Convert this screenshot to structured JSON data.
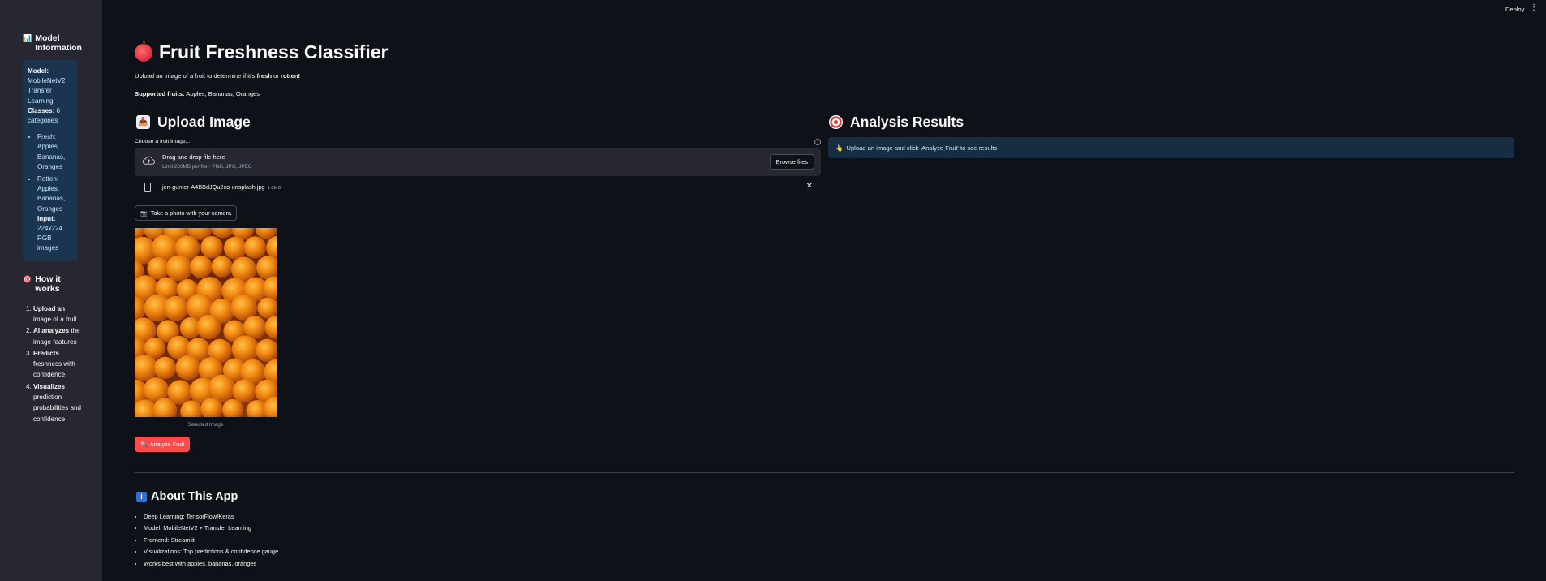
{
  "topbar": {
    "deploy_label": "Deploy",
    "menu_icon": "⋮"
  },
  "sidebar": {
    "model_info_title": "Model Information",
    "model_label": "Model:",
    "model_value": "MobileNetV2 Transfer Learning",
    "classes_label": "Classes:",
    "classes_value": "6 categories",
    "fresh_label": "Fresh:",
    "fresh_value": "Apples, Bananas, Oranges",
    "rotten_label": "Rotten:",
    "rotten_value": "Apples, Bananas, Oranges",
    "input_label": "Input:",
    "input_value": "224x224 RGB images",
    "how_title": "How it works",
    "steps": [
      {
        "bold": "Upload an",
        "rest": "image of a fruit"
      },
      {
        "bold": "AI analyzes",
        "rest": "the image features"
      },
      {
        "bold": "Predicts",
        "rest": "freshness with confidence"
      },
      {
        "bold": "Visualizes",
        "rest": "prediction probabilities and confidence"
      }
    ]
  },
  "main": {
    "title": "Fruit Freshness Classifier",
    "subtitle_pre": "Upload an image of a fruit to determine if it's ",
    "subtitle_fresh": "fresh",
    "subtitle_mid": " or ",
    "subtitle_rotten": "rotten",
    "subtitle_end": "!",
    "supported_label": "Supported fruits:",
    "supported_value": "Apples, Bananas, Oranges"
  },
  "upload": {
    "heading": "Upload Image",
    "choose_label": "Choose a fruit image...",
    "drop_title": "Drag and drop file here",
    "drop_limit": "Limit 200MB per file • PNG, JPG, JPEG",
    "browse_label": "Browse files",
    "file_name": "jen-gunter-A4BBdJQu2co-unsplash.jpg",
    "file_size": "1.8MB",
    "camera_label": "Take a photo with your camera",
    "image_caption": "Selected Image",
    "analyze_label": "Analyze Fruit"
  },
  "results": {
    "heading": "Analysis Results",
    "info_text": "Upload an image and click 'Analyze Fruit' to see results"
  },
  "about": {
    "heading": "About This App",
    "items": [
      {
        "label": "Deep Learning:",
        "value": "TensorFlow/Keras"
      },
      {
        "label": "Model:",
        "value": "MobileNetV2 + Transfer Learning"
      },
      {
        "label": "Frontend:",
        "value": "Streamlit"
      },
      {
        "label": "Visualizations:",
        "value": "Top predictions & confidence gauge"
      },
      {
        "label": "",
        "value": "Works best with apples, bananas, oranges"
      }
    ]
  },
  "colors": {
    "accent": "#ff4b4b",
    "info_bg": "#172d43",
    "sidebar_bg": "#262730",
    "page_bg": "#0e1117"
  }
}
